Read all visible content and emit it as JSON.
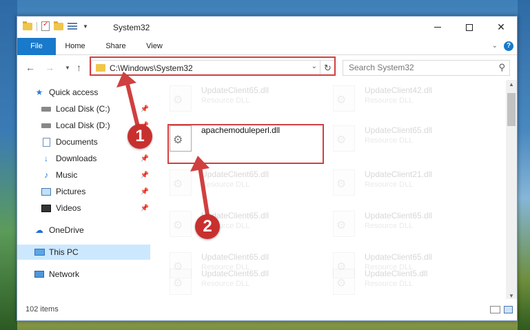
{
  "window": {
    "title": "System32"
  },
  "ribbon": {
    "tabs": [
      "File",
      "Home",
      "Share",
      "View"
    ],
    "help": "?"
  },
  "navigation": {
    "address_path": "C:\\Windows\\System32",
    "search_placeholder": "Search System32"
  },
  "sidebar": {
    "items": [
      {
        "label": "Quick access",
        "icon": "star-icon"
      },
      {
        "label": "Local Disk (C:)",
        "icon": "drive-icon",
        "pinned": true
      },
      {
        "label": "Local Disk (D:)",
        "icon": "drive-icon",
        "pinned": true
      },
      {
        "label": "Documents",
        "icon": "documents-icon",
        "pinned": true
      },
      {
        "label": "Downloads",
        "icon": "download-icon",
        "pinned": true
      },
      {
        "label": "Music",
        "icon": "music-icon",
        "pinned": true
      },
      {
        "label": "Pictures",
        "icon": "pictures-icon",
        "pinned": true
      },
      {
        "label": "Videos",
        "icon": "videos-icon",
        "pinned": true
      },
      {
        "label": "OneDrive",
        "icon": "cloud-icon"
      },
      {
        "label": "This PC",
        "icon": "computer-icon",
        "selected": true
      },
      {
        "label": "Network",
        "icon": "network-icon"
      }
    ]
  },
  "files": [
    {
      "name": "UpdateClient65.dll",
      "type": "Resource DLL",
      "faded": true
    },
    {
      "name": "UpdateClient42.dll",
      "type": "Resource DLL",
      "faded": true
    },
    {
      "name": "apachemoduleperl.dll",
      "type": "",
      "faded": false
    },
    {
      "name": "UpdateClient65.dll",
      "type": "Resource DLL",
      "faded": true
    },
    {
      "name": "UpdateClient65.dll",
      "type": "Resource DLL",
      "faded": true
    },
    {
      "name": "UpdateClient21.dll",
      "type": "Resource DLL",
      "faded": true
    },
    {
      "name": "UpdateClient65.dll",
      "type": "Resource DLL",
      "faded": true
    },
    {
      "name": "UpdateClient65.dll",
      "type": "Resource DLL",
      "faded": true
    },
    {
      "name": "UpdateClient65.dll",
      "type": "Resource DLL",
      "faded": true
    },
    {
      "name": "UpdateClient65.dll",
      "type": "Resource DLL",
      "faded": true
    },
    {
      "name": "UpdateClient65.dll",
      "type": "Resource DLL",
      "faded": true
    },
    {
      "name": "UpdateClient5.dll",
      "type": "Resource DLL",
      "faded": true
    }
  ],
  "status": {
    "item_count": "102 items"
  },
  "annotations": {
    "callout_1": "1",
    "callout_2": "2",
    "color": "#d04040"
  },
  "colors": {
    "accent": "#1979ca",
    "selected_bg": "#cce8ff"
  }
}
